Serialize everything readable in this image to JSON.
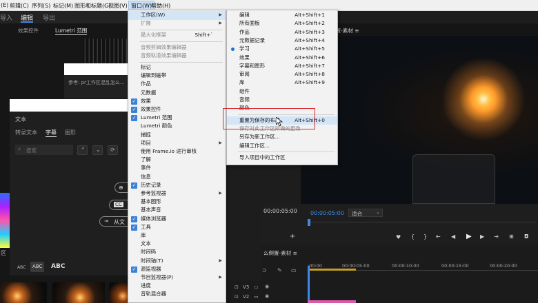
{
  "menubar": {
    "items": [
      "(E)",
      "剪辑(C)",
      "序列(S)",
      "标记(M)",
      "图形和标题(G)",
      "视图(V)",
      "窗口(W)",
      "帮助(H)"
    ]
  },
  "workspace_tabs": [
    "导入",
    "编辑",
    "导出"
  ],
  "left_panel": {
    "tabs": [
      "效果控件",
      "Lumetri 范围"
    ],
    "hint_text": "参考: pr工作区混乱怎么...",
    "text_panel_title": "文本",
    "text_tabs": [
      "转录文本",
      "字幕",
      "图形"
    ],
    "search_placeholder": "搜索",
    "buttons": [
      "",
      "",
      "从文"
    ],
    "abc_styles": [
      "ABC",
      "ABC",
      "ABC"
    ],
    "side_label": "区"
  },
  "program_monitor": {
    "tab": "...混乱怎么倒置-素材 ≡",
    "timecode_left": "00:00:05:00",
    "timecode_right": "00:00:05:00",
    "fit_label": "适合"
  },
  "timeline": {
    "tab": "么倒置-素材 ≡",
    "ruler": [
      ":00:00",
      "00:00:05:00",
      "00:00:10:00",
      "00:00:15:00",
      "00:00:20:00"
    ],
    "tracks": [
      "V3",
      "V2"
    ]
  },
  "window_menu": {
    "items": [
      {
        "label": "工作区(W)",
        "arrow": true,
        "highlight": true
      },
      {
        "label": "扩展",
        "arrow": true,
        "disabled": true
      },
      {
        "sep": true
      },
      {
        "label": "最大化框架",
        "shortcut": "Shift+`",
        "disabled": true
      },
      {
        "sep": true
      },
      {
        "label": "音频剪辑效果编辑器",
        "disabled": true
      },
      {
        "label": "音频轨道效果编辑器",
        "disabled": true
      },
      {
        "sep": true
      },
      {
        "label": "标记"
      },
      {
        "label": "编辑到磁带"
      },
      {
        "label": "作品"
      },
      {
        "label": "元数据"
      },
      {
        "label": "效果",
        "checked": true
      },
      {
        "label": "效果控件",
        "checked": true
      },
      {
        "label": "Lumetri 范围",
        "checked": true
      },
      {
        "label": "Lumetri 颜色"
      },
      {
        "label": "捕捉"
      },
      {
        "label": "项目",
        "arrow": true
      },
      {
        "label": "使用 Frame.io 进行审核"
      },
      {
        "label": "了解"
      },
      {
        "label": "事件"
      },
      {
        "label": "信息"
      },
      {
        "label": "历史记录",
        "checked": true
      },
      {
        "label": "参考监视器",
        "arrow": true
      },
      {
        "label": "基本图形"
      },
      {
        "label": "基本声音"
      },
      {
        "label": "媒体浏览器",
        "checked": true
      },
      {
        "label": "工具",
        "checked": true
      },
      {
        "label": "库"
      },
      {
        "label": "文本"
      },
      {
        "label": "时间码"
      },
      {
        "label": "时间轴(T)",
        "arrow": true
      },
      {
        "label": "源监视器",
        "checked": true
      },
      {
        "label": "节目监视器(P)",
        "arrow": true
      },
      {
        "label": "进度"
      },
      {
        "label": "音轨混合器"
      }
    ]
  },
  "workspace_submenu": {
    "items": [
      {
        "label": "编辑",
        "shortcut": "Alt+Shift+1"
      },
      {
        "label": "所有面板",
        "shortcut": "Alt+Shift+2"
      },
      {
        "label": "作品",
        "shortcut": "Alt+Shift+3"
      },
      {
        "label": "元数据记录",
        "shortcut": "Alt+Shift+4"
      },
      {
        "label": "学习",
        "shortcut": "Alt+Shift+5",
        "radio": true
      },
      {
        "label": "效果",
        "shortcut": "Alt+Shift+6"
      },
      {
        "label": "字幕和图形",
        "shortcut": "Alt+Shift+7"
      },
      {
        "label": "审阅",
        "shortcut": "Alt+Shift+8"
      },
      {
        "label": "库",
        "shortcut": "Alt+Shift+9"
      },
      {
        "label": "组件"
      },
      {
        "label": "音频"
      },
      {
        "label": "颜色"
      },
      {
        "sep": true
      },
      {
        "label": "重置为保存的布局",
        "shortcut": "Alt+Shift+0",
        "highlight": true
      },
      {
        "label": "保存对此工作区所做的更改",
        "disabled": true
      },
      {
        "label": "另存为新工作区..."
      },
      {
        "label": "编辑工作区..."
      },
      {
        "sep": true
      },
      {
        "label": "导入项目中的工作区"
      }
    ]
  },
  "colors": {
    "accent": "#3b82d6",
    "highlight_box": "#d9262c",
    "timecode_blue": "#3f8ae8"
  }
}
